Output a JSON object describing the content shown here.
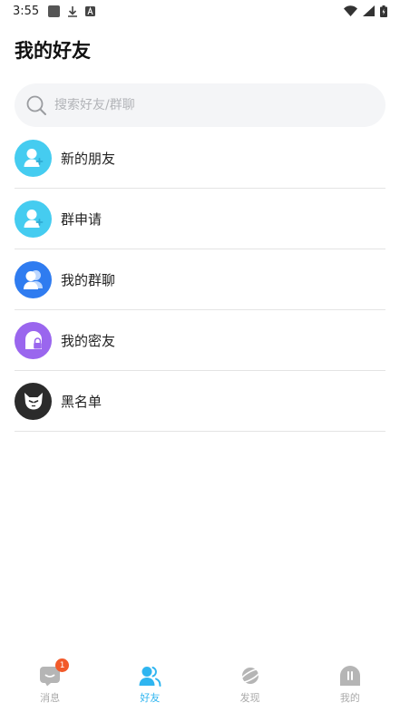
{
  "status_bar": {
    "time": "3:55"
  },
  "page_title": "我的好友",
  "search": {
    "placeholder": "搜索好友/群聊"
  },
  "menu": [
    {
      "label": "新的朋友",
      "icon": "add-person-icon",
      "color": "#45ccf0"
    },
    {
      "label": "群申请",
      "icon": "add-person-icon",
      "color": "#45ccf0"
    },
    {
      "label": "我的群聊",
      "icon": "group-icon",
      "color": "#2f7cf0"
    },
    {
      "label": "我的密友",
      "icon": "lock-icon",
      "color": "#9a66ee"
    },
    {
      "label": "黑名单",
      "icon": "cat-mask-icon",
      "color": "#2b2b2b"
    }
  ],
  "tabs": [
    {
      "label": "消息",
      "icon": "chat-icon",
      "badge": "1"
    },
    {
      "label": "好友",
      "icon": "friends-icon"
    },
    {
      "label": "发现",
      "icon": "planet-icon"
    },
    {
      "label": "我的",
      "icon": "profile-icon"
    }
  ],
  "colors": {
    "accent": "#2fb5f0",
    "badge": "#f25a2a",
    "inactive": "#aaaaaa"
  }
}
